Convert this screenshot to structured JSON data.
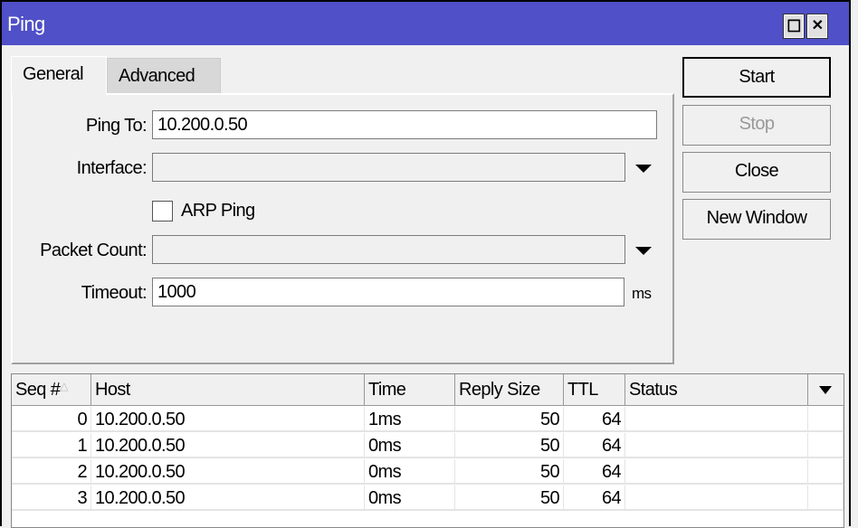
{
  "window": {
    "title": "Ping"
  },
  "tabs": [
    {
      "label": "General",
      "active": true
    },
    {
      "label": "Advanced",
      "active": false
    }
  ],
  "form": {
    "ping_to": {
      "label": "Ping To:",
      "value": "10.200.0.50"
    },
    "interface": {
      "label": "Interface:",
      "value": ""
    },
    "arp_ping": {
      "label": "ARP Ping",
      "checked": false
    },
    "packet_count": {
      "label": "Packet Count:",
      "value": ""
    },
    "timeout": {
      "label": "Timeout:",
      "value": "1000",
      "unit": "ms"
    }
  },
  "buttons": {
    "start": "Start",
    "stop": "Stop",
    "close": "Close",
    "new_window": "New Window"
  },
  "table": {
    "columns": [
      "Seq #",
      "Host",
      "Time",
      "Reply Size",
      "TTL",
      "Status"
    ],
    "rows": [
      {
        "seq": "0",
        "host": "10.200.0.50",
        "time": "1ms",
        "reply_size": "50",
        "ttl": "64",
        "status": ""
      },
      {
        "seq": "1",
        "host": "10.200.0.50",
        "time": "0ms",
        "reply_size": "50",
        "ttl": "64",
        "status": ""
      },
      {
        "seq": "2",
        "host": "10.200.0.50",
        "time": "0ms",
        "reply_size": "50",
        "ttl": "64",
        "status": ""
      },
      {
        "seq": "3",
        "host": "10.200.0.50",
        "time": "0ms",
        "reply_size": "50",
        "ttl": "64",
        "status": ""
      }
    ]
  },
  "colors": {
    "titlebar": "#5050c8"
  }
}
